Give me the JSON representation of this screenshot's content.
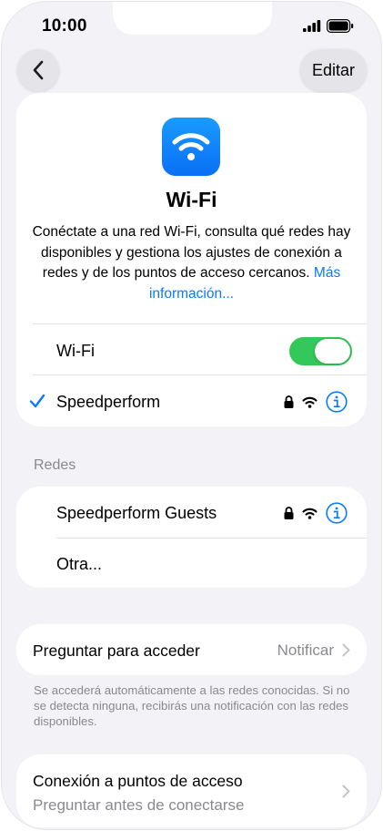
{
  "status_bar": {
    "time": "10:00"
  },
  "nav": {
    "back_icon": "chevron-left-icon",
    "edit_label": "Editar"
  },
  "hero": {
    "icon": "wifi-icon",
    "title": "Wi-Fi",
    "description": "Conéctate a una red Wi-Fi, consulta qué redes hay disponibles y gestiona los ajustes de conexión a redes y de los puntos de acceso cercanos.",
    "link": "Más información..."
  },
  "wifi_toggle": {
    "label": "Wi-Fi",
    "on": true,
    "color": "#34c759"
  },
  "connected_network": {
    "name": "Speedperform",
    "locked": true,
    "checked": true
  },
  "networks_section": {
    "title": "Redes",
    "items": [
      {
        "name": "Speedperform Guests",
        "locked": true
      },
      {
        "name": "Otra..."
      }
    ]
  },
  "ask_to_join": {
    "label": "Preguntar para acceder",
    "value": "Notificar"
  },
  "ask_footnote": "Se accederá automáticamente a las redes conocidas. Si no se detecta ninguna, recibirás una notificación con las redes disponibles.",
  "hotspot": {
    "label": "Conexión a puntos de acceso",
    "value": "Preguntar antes de conectarse"
  },
  "colors": {
    "accent": "#0a7aff",
    "background": "#f2f2f7",
    "secondary_text": "#8a8a8e"
  }
}
